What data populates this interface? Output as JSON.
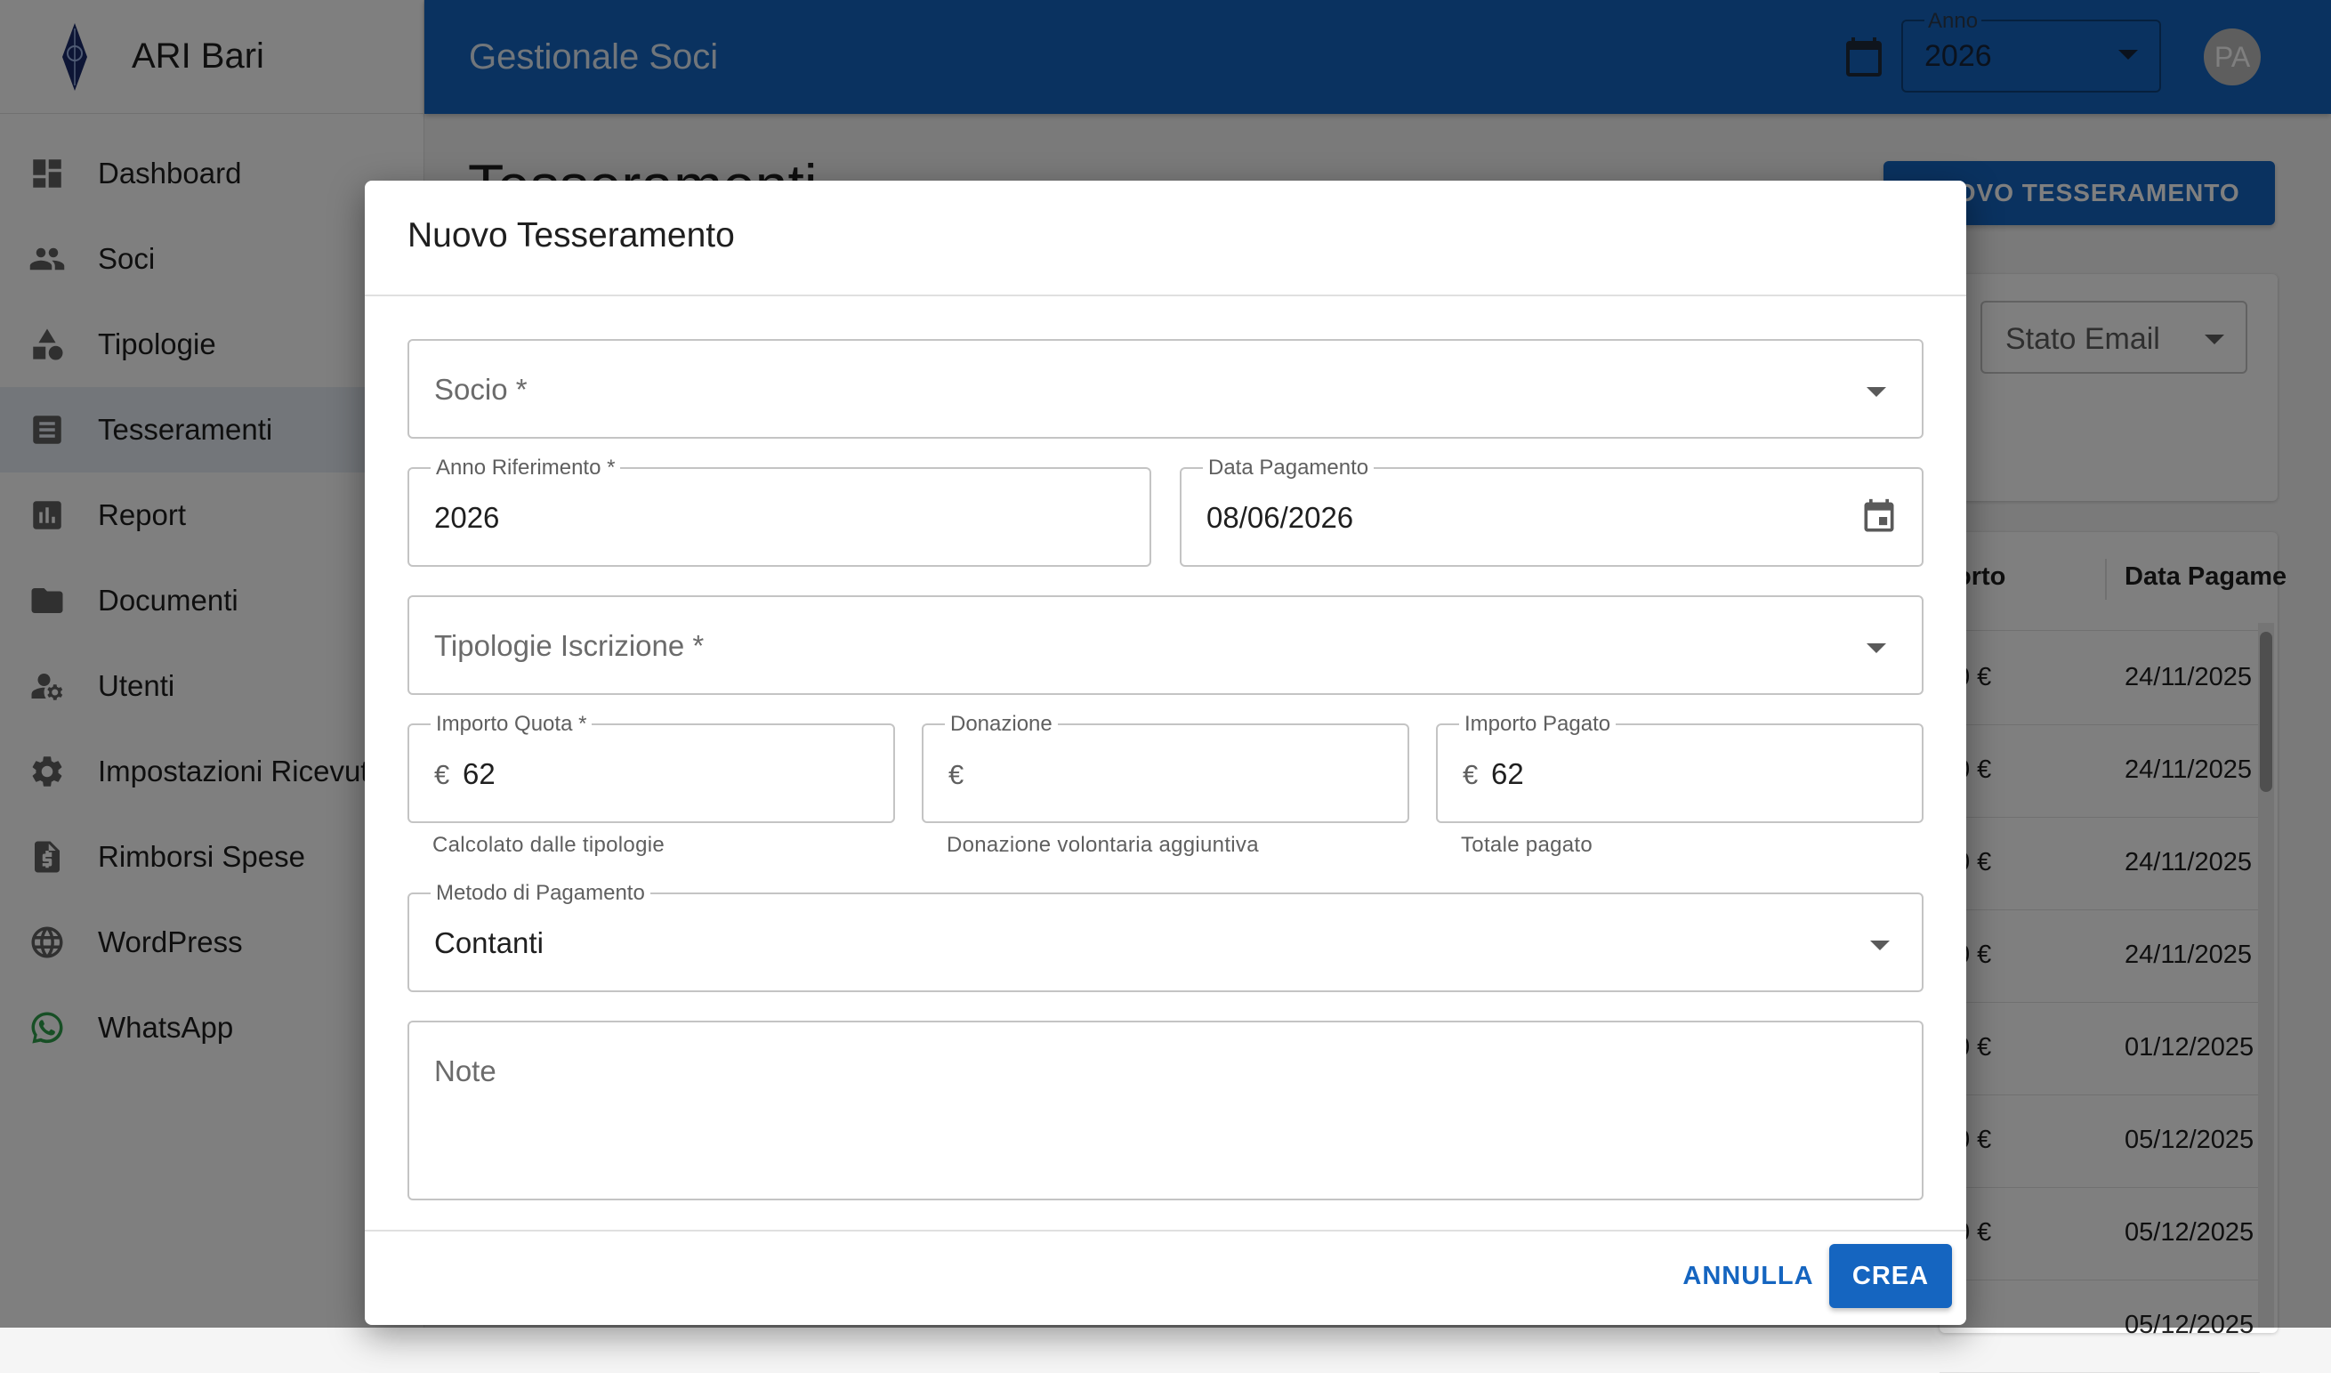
{
  "app": {
    "brand_name": "ARI Bari",
    "title": "Gestionale Soci"
  },
  "colors": {
    "primary": "#1565c0",
    "sidebar_active": "#e7edf5"
  },
  "sidebar": {
    "items": [
      {
        "label": "Dashboard",
        "icon": "dashboard-icon"
      },
      {
        "label": "Soci",
        "icon": "people-icon"
      },
      {
        "label": "Tipologie",
        "icon": "category-icon"
      },
      {
        "label": "Tesseramenti",
        "icon": "list-icon",
        "active": true
      },
      {
        "label": "Report",
        "icon": "bar-chart-icon"
      },
      {
        "label": "Documenti",
        "icon": "folder-icon"
      },
      {
        "label": "Utenti",
        "icon": "user-settings-icon"
      },
      {
        "label": "Impostazioni Ricevute",
        "icon": "gear-icon"
      },
      {
        "label": "Rimborsi Spese",
        "icon": "receipt-dollar-icon"
      },
      {
        "label": "WordPress",
        "icon": "globe-icon"
      },
      {
        "label": "WhatsApp",
        "icon": "whatsapp-icon"
      }
    ]
  },
  "header": {
    "year_label": "Anno",
    "year_value": "2026",
    "avatar_initials": "PA"
  },
  "page": {
    "heading": "Tesseramenti",
    "new_button": "NUOVO TESSERAMENTO",
    "filter_email_label": "Stato Email",
    "table": {
      "headers": [
        "orto",
        "Data Pagame"
      ],
      "rows": [
        {
          "amount": "0 €",
          "date": "24/11/2025"
        },
        {
          "amount": "0 €",
          "date": "24/11/2025"
        },
        {
          "amount": "0 €",
          "date": "24/11/2025"
        },
        {
          "amount": "0 €",
          "date": "24/11/2025"
        },
        {
          "amount": "0 €",
          "date": "01/12/2025"
        },
        {
          "amount": "0 €",
          "date": "05/12/2025"
        },
        {
          "amount": "0 €",
          "date": "05/12/2025"
        },
        {
          "amount": "",
          "date": "05/12/2025"
        }
      ]
    }
  },
  "dialog": {
    "title": "Nuovo Tesseramento",
    "socio": {
      "placeholder": "Socio *"
    },
    "anno_riferimento": {
      "label": "Anno Riferimento *",
      "value": "2026"
    },
    "data_pagamento": {
      "label": "Data Pagamento",
      "value": "08/06/2026"
    },
    "tipologie": {
      "placeholder": "Tipologie Iscrizione *"
    },
    "importo_quota": {
      "label": "Importo Quota *",
      "currency": "€",
      "value": "62",
      "helper": "Calcolato dalle tipologie"
    },
    "donazione": {
      "label": "Donazione",
      "currency": "€",
      "value": "",
      "helper": "Donazione volontaria aggiuntiva"
    },
    "importo_pagato": {
      "label": "Importo Pagato",
      "currency": "€",
      "value": "62",
      "helper": "Totale pagato"
    },
    "metodo_pagamento": {
      "label": "Metodo di Pagamento",
      "value": "Contanti"
    },
    "note": {
      "placeholder": "Note"
    },
    "cancel_label": "ANNULLA",
    "create_label": "CREA"
  }
}
